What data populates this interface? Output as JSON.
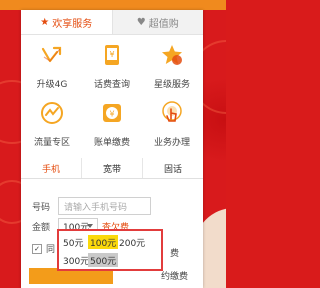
{
  "tabs": {
    "service": "欢享服务",
    "shop": "超值购"
  },
  "grid": [
    {
      "label": "升级4G",
      "icon": "phone-4g-icon"
    },
    {
      "label": "话费查询",
      "icon": "phone-bill-icon"
    },
    {
      "label": "星级服务",
      "icon": "star-service-icon"
    },
    {
      "label": "流量专区",
      "icon": "data-traffic-icon"
    },
    {
      "label": "账单缴费",
      "icon": "bill-pay-icon"
    },
    {
      "label": "业务办理",
      "icon": "touch-business-icon"
    }
  ],
  "subtabs": {
    "mobile": "手机",
    "broadband": "宽带",
    "fixed": "固话"
  },
  "form": {
    "phone_label": "号码",
    "phone_placeholder": "请输入手机号码",
    "amount_label": "金额",
    "amount_value": "100元",
    "check_balance": "查欠费",
    "agree_prefix": "同",
    "right1": "费",
    "right2": "约缴费"
  },
  "amount_options": [
    "50元",
    "100元",
    "200元",
    "300元",
    "500元"
  ],
  "colors": {
    "accent": "#e44c0f",
    "highlight": "#fbd90a",
    "popup_border": "#e23c3c"
  }
}
